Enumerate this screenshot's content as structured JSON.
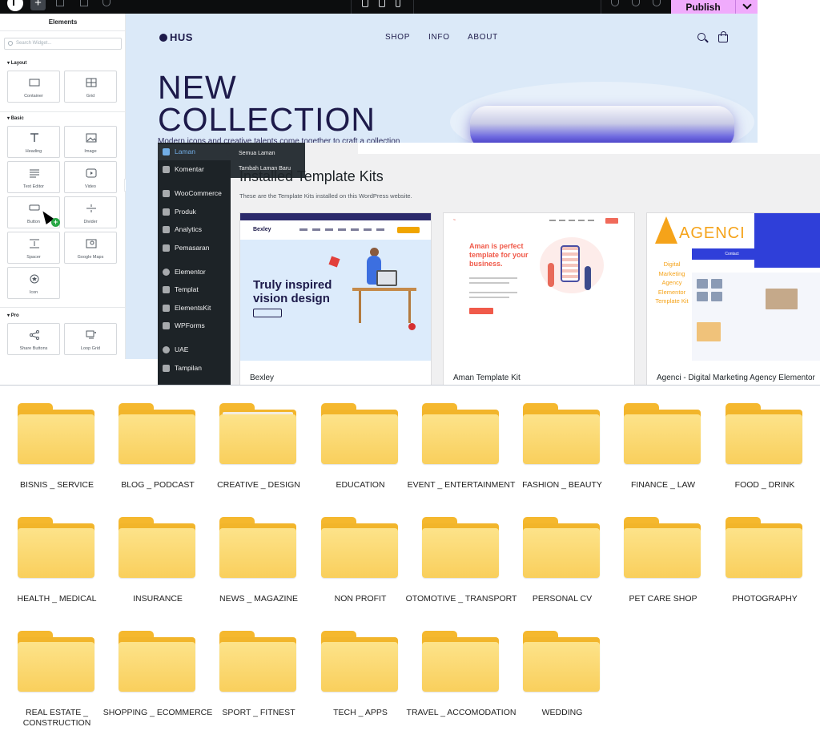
{
  "editor": {
    "topbar": {
      "publish_label": "Publish"
    },
    "panel": {
      "title": "Elements",
      "search_placeholder": "Search Widget...",
      "categories": [
        "Layout",
        "Basic",
        "Pro"
      ],
      "layout_widgets": [
        "Container",
        "Grid"
      ],
      "basic_widgets": [
        "Heading",
        "Image",
        "Text Editor",
        "Video",
        "Button",
        "Divider",
        "Spacer",
        "Google Maps",
        "Icon"
      ],
      "pro_widgets": [
        "Share Buttons",
        "Loop Grid"
      ]
    },
    "site": {
      "brand": "HUS",
      "nav": [
        "SHOP",
        "INFO",
        "ABOUT"
      ],
      "hero_line1": "NEW",
      "hero_line2": "COLLECTION",
      "hero_sub": "Modern icons and creative talents come together to craft a collection"
    }
  },
  "wp": {
    "menu": [
      {
        "label": "Laman",
        "icon": "pages-icon"
      },
      {
        "label": "Komentar",
        "icon": "comments-icon"
      },
      {
        "label": "WooCommerce",
        "icon": "woocommerce-icon"
      },
      {
        "label": "Produk",
        "icon": "products-icon"
      },
      {
        "label": "Analytics",
        "icon": "analytics-icon"
      },
      {
        "label": "Pemasaran",
        "icon": "marketing-icon"
      },
      {
        "label": "Elementor",
        "icon": "elementor-icon"
      },
      {
        "label": "Templat",
        "icon": "templates-icon"
      },
      {
        "label": "ElementsKit",
        "icon": "elementskit-icon"
      },
      {
        "label": "WPForms",
        "icon": "wpforms-icon"
      },
      {
        "label": "UAE",
        "icon": "uae-icon"
      },
      {
        "label": "Tampilan",
        "icon": "appearance-icon"
      }
    ],
    "submenu": [
      "Semua Laman",
      "Tambah Laman Baru"
    ],
    "heading": "Installed Template Kits",
    "description": "These are the Template Kits installed on this WordPress website.",
    "kits": [
      {
        "name": "Bexley",
        "thumb_logo": "Bexley",
        "thumb_headline": "Truly inspired vision design"
      },
      {
        "name": "Aman Template Kit",
        "thumb_headline": "Aman is perfect template for your business."
      },
      {
        "name": "Agenci - Digital Marketing Agency Elementor",
        "thumb_logo": "AGENCI",
        "thumb_text": "Digital Marketing Agency Elementor Template Kit",
        "thumb_contact": "Contact"
      }
    ]
  },
  "folders": [
    "BISNIS _ SERVICE",
    "BLOG _ PODCAST",
    "CREATIVE _ DESIGN",
    "EDUCATION",
    "EVENT _ ENTERTAINMENT",
    "FASHION _ BEAUTY",
    "FINANCE _ LAW",
    "FOOD _ DRINK",
    "HEALTH _ MEDICAL",
    "INSURANCE",
    "NEWS _ MAGAZINE",
    "NON PROFIT",
    "OTOMOTIVE _ TRANSPORT",
    "PERSONAL CV",
    "PET CARE SHOP",
    "PHOTOGRAPHY",
    "REAL ESTATE _ CONSTRUCTION",
    "SHOPPING _ ECOMMERCE",
    "SPORT _ FITNEST",
    "TECH _ APPS",
    "TRAVEL _ ACCOMODATION",
    "WEDDING"
  ],
  "colors": {
    "publish": "#f0abfc",
    "folder": "#f9cf5c",
    "wp_sidebar": "#1d2327",
    "hero_text": "#1d1a4a",
    "accent_orange": "#f5a31a"
  }
}
